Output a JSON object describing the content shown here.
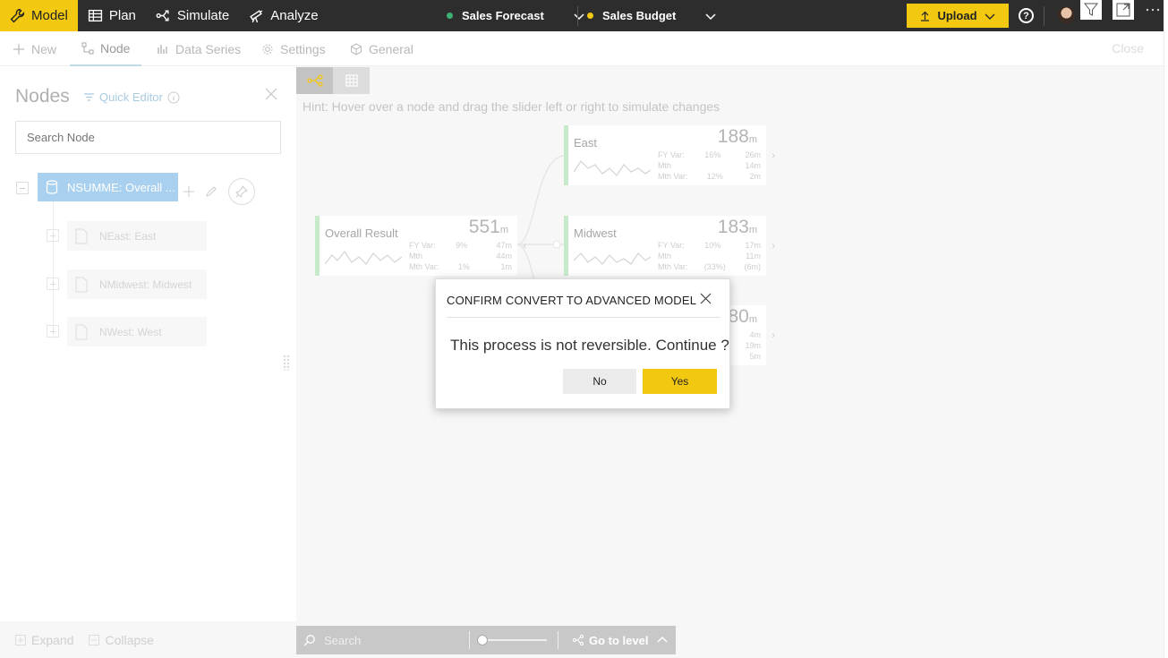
{
  "topbar": {
    "tabs": [
      {
        "label": "Model",
        "icon": "wrench-icon"
      },
      {
        "label": "Plan",
        "icon": "table-icon"
      },
      {
        "label": "Simulate",
        "icon": "branch-icon"
      },
      {
        "label": "Analyze",
        "icon": "telescope-icon"
      }
    ],
    "scenario1": {
      "label": "Sales Forecast",
      "color": "#3bb273"
    },
    "scenario2": {
      "label": "Sales Budget",
      "color": "#f2c811"
    },
    "upload_label": "Upload",
    "help_label": "?"
  },
  "subnav": {
    "items": [
      {
        "label": "New"
      },
      {
        "label": "Node"
      },
      {
        "label": "Data Series"
      },
      {
        "label": "Settings"
      },
      {
        "label": "General"
      }
    ],
    "close_label": "Close"
  },
  "left": {
    "title": "Nodes",
    "quick_editor": "Quick Editor",
    "search_placeholder": "Search Node",
    "root": "NSUMME: Overall ...",
    "children": [
      "NEast: East",
      "NMidwest: Midwest",
      "NWest: West"
    ],
    "expand": "Expand",
    "collapse": "Collapse"
  },
  "canvas": {
    "hint": "Hint: Hover over a node and drag the slider left or right to simulate changes",
    "overall": {
      "name": "Overall Result",
      "value": "551",
      "unit": "m",
      "rows": [
        [
          "FY Var:",
          "9%",
          "47m"
        ],
        [
          "Mth",
          "",
          "44m"
        ],
        [
          "Mth Var:",
          "1%",
          "1m"
        ]
      ]
    },
    "east": {
      "name": "East",
      "value": "188",
      "unit": "m",
      "rows": [
        [
          "FY Var:",
          "16%",
          "26m"
        ],
        [
          "Mth",
          "",
          "14m"
        ],
        [
          "Mth Var:",
          "12%",
          "2m"
        ]
      ]
    },
    "midwest": {
      "name": "Midwest",
      "value": "183",
      "unit": "m",
      "rows": [
        [
          "FY Var:",
          "10%",
          "17m"
        ],
        [
          "Mth",
          "",
          "11m"
        ],
        [
          "Mth Var:",
          "(33%)",
          "(6m)"
        ]
      ]
    },
    "west": {
      "value": "80",
      "unit": "m",
      "rows": [
        "4m",
        "19m",
        "5m"
      ]
    },
    "search_placeholder": "Search",
    "go_to_level": "Go to level"
  },
  "modal": {
    "title": "CONFIRM CONVERT TO ADVANCED MODEL",
    "message": "This process is not reversible. Continue ?",
    "no_label": "No",
    "yes_label": "Yes"
  }
}
